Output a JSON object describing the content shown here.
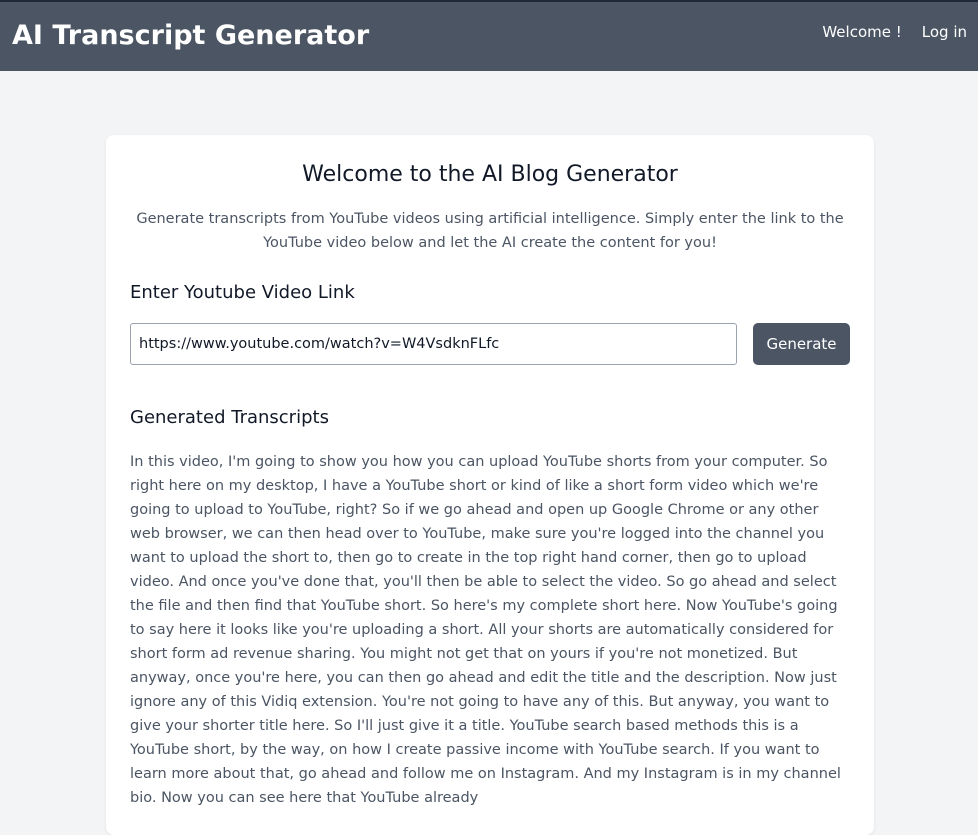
{
  "header": {
    "brand": "AI Transcript Generator",
    "welcome": "Welcome !",
    "login": "Log in"
  },
  "main": {
    "title": "Welcome to the AI Blog Generator",
    "description": "Generate transcripts from YouTube videos using artificial intelligence. Simply enter the link to the YouTube video below and let the AI create the content for you!",
    "link_label": "Enter Youtube Video Link",
    "url_value": "https://www.youtube.com/watch?v=W4VsdknFLfc",
    "generate_label": "Generate",
    "transcripts_label": "Generated Transcripts",
    "transcript_text": "In this video, I'm going to show you how you can upload YouTube shorts from your computer. So right here on my desktop, I have a YouTube short or kind of like a short form video which we're going to upload to YouTube, right? So if we go ahead and open up Google Chrome or any other web browser, we can then head over to YouTube, make sure you're logged into the channel you want to upload the short to, then go to create in the top right hand corner, then go to upload video. And once you've done that, you'll then be able to select the video. So go ahead and select the file and then find that YouTube short. So here's my complete short here. Now YouTube's going to say here it looks like you're uploading a short. All your shorts are automatically considered for short form ad revenue sharing. You might not get that on yours if you're not monetized. But anyway, once you're here, you can then go ahead and edit the title and the description. Now just ignore any of this Vidiq extension. You're not going to have any of this. But anyway, you want to give your shorter title here. So I'll just give it a title. YouTube search based methods this is a YouTube short, by the way, on how I create passive income with YouTube search. If you want to learn more about that, go ahead and follow me on Instagram. And my Instagram is in my channel bio. Now you can see here that YouTube already"
  },
  "colors": {
    "navbar": "#4b5563",
    "background": "#f3f4f6",
    "button": "#4b5563"
  }
}
